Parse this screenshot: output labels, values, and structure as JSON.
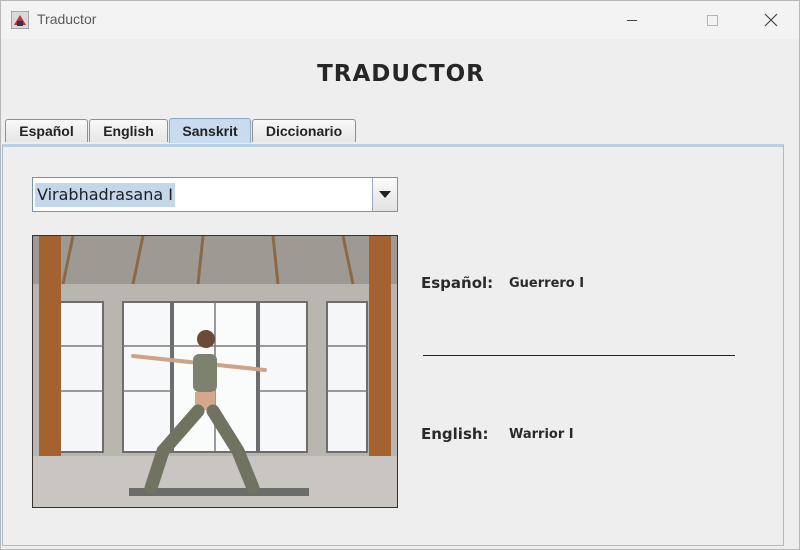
{
  "window": {
    "title": "Traductor"
  },
  "heading": "TRADUCTOR",
  "tabs": [
    {
      "label": "Español",
      "active": false
    },
    {
      "label": "English",
      "active": false
    },
    {
      "label": "Sanskrit",
      "active": true
    },
    {
      "label": "Diccionario",
      "active": false
    }
  ],
  "pose_select": {
    "selected": "Virabhadrasana I"
  },
  "image": {
    "subject": "yoga-pose-warrior-photo"
  },
  "translations": {
    "spanish_label": "Español:",
    "spanish_value": "Guerrero I",
    "english_label": "English:",
    "english_value": "Warrior I"
  },
  "colors": {
    "active_tab": "#c9dcef",
    "selection_highlight": "#c3d6ea",
    "panel_border": "#a6bccf"
  }
}
